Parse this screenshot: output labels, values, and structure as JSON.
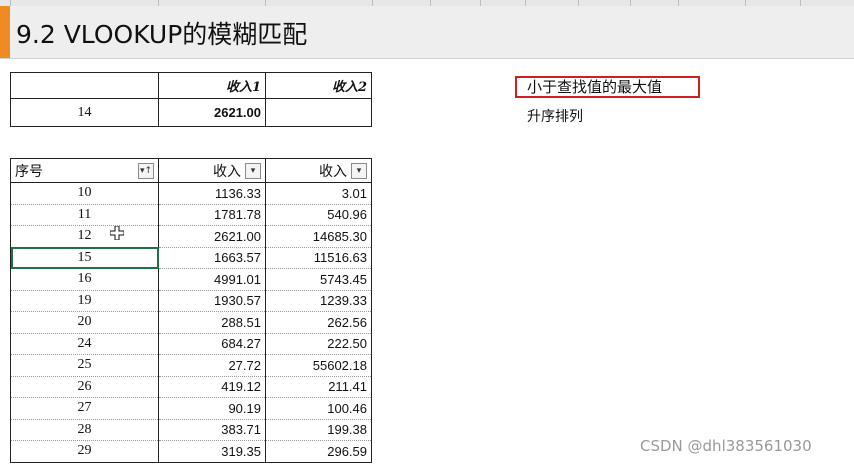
{
  "title": "9.2 VLOOKUP的模糊匹配",
  "lookup_table": {
    "headers": [
      "",
      "收入1",
      "收入2"
    ],
    "row": {
      "key": "14",
      "income1": "2621.00",
      "income2": ""
    }
  },
  "data_table": {
    "headers": {
      "seq": "序号",
      "income1": "收入",
      "income2": "收入"
    },
    "filter_icons": {
      "seq": "sort-filter-icon",
      "income1": "dropdown-icon",
      "income2": "dropdown-icon"
    },
    "rows": [
      {
        "seq": "10",
        "income1": "1136.33",
        "income2": "3.01"
      },
      {
        "seq": "11",
        "income1": "1781.78",
        "income2": "540.96"
      },
      {
        "seq": "12",
        "income1": "2621.00",
        "income2": "14685.30"
      },
      {
        "seq": "15",
        "income1": "1663.57",
        "income2": "11516.63"
      },
      {
        "seq": "16",
        "income1": "4991.01",
        "income2": "5743.45"
      },
      {
        "seq": "19",
        "income1": "1930.57",
        "income2": "1239.33"
      },
      {
        "seq": "20",
        "income1": "288.51",
        "income2": "262.56"
      },
      {
        "seq": "24",
        "income1": "684.27",
        "income2": "222.50"
      },
      {
        "seq": "25",
        "income1": "27.72",
        "income2": "55602.18"
      },
      {
        "seq": "26",
        "income1": "419.12",
        "income2": "211.41"
      },
      {
        "seq": "27",
        "income1": "90.19",
        "income2": "100.46"
      },
      {
        "seq": "28",
        "income1": "383.71",
        "income2": "199.38"
      },
      {
        "seq": "29",
        "income1": "319.35",
        "income2": "296.59"
      }
    ]
  },
  "notes": {
    "boxed": "小于查找值的最大值",
    "plain": "升序排列"
  },
  "watermark": "CSDN @dhl383561030",
  "colors": {
    "accent": "#f08a24",
    "highlight_border": "#d11f1f",
    "selection": "#1e7145"
  }
}
